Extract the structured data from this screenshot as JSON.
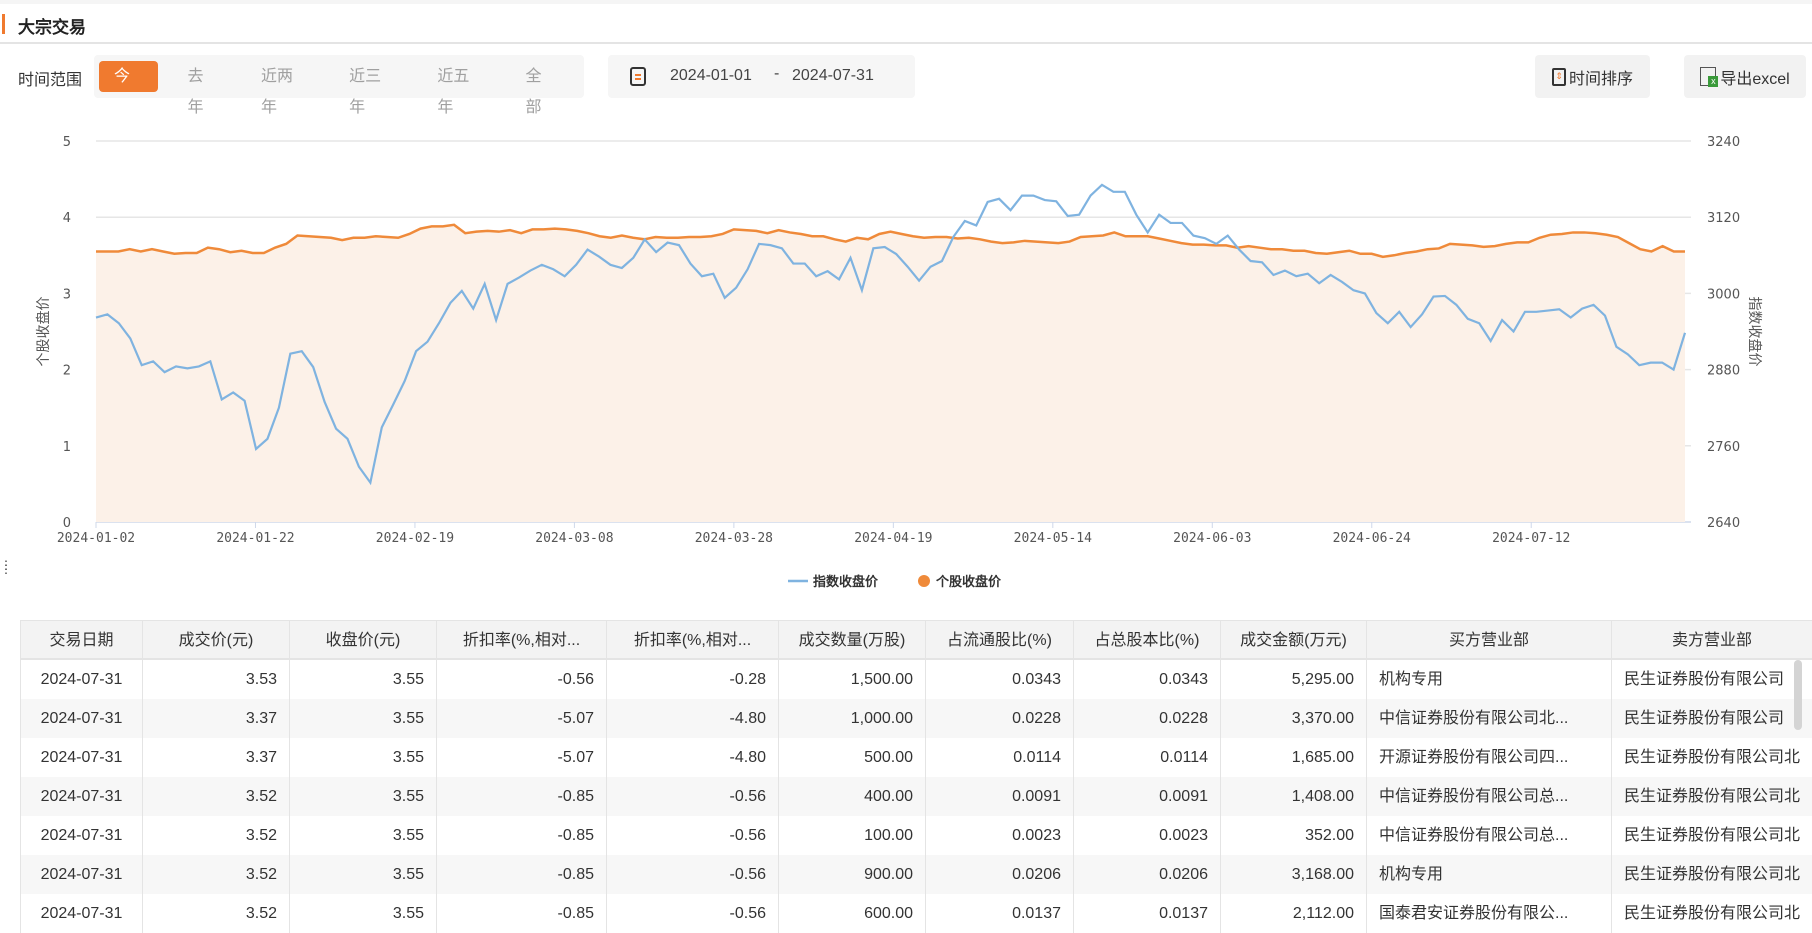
{
  "header": {
    "title": "大宗交易"
  },
  "filter": {
    "label": "时间范围",
    "ranges": [
      "今年",
      "去年",
      "近两年",
      "近三年",
      "近五年",
      "全部"
    ],
    "active": "今年"
  },
  "date_range": {
    "start": "2024-01-01",
    "sep": "-",
    "end": "2024-07-31"
  },
  "actions": {
    "sort_label": "时间排序",
    "export_label": "导出excel"
  },
  "colors": {
    "accent": "#f07a2f",
    "index_line": "#7fb3e0",
    "stock_line": "#ef8a3a",
    "area": "#fcf1e8"
  },
  "chart_data": {
    "type": "line",
    "left_ylabel": "个股收盘价",
    "right_ylabel": "指数收盘价",
    "left_ylim": [
      0,
      5
    ],
    "left_ticks": [
      "0",
      "1",
      "2",
      "3",
      "4",
      "5"
    ],
    "right_ylim": [
      2640,
      3240
    ],
    "right_ticks": [
      "2640",
      "2760",
      "2880",
      "3000",
      "3120",
      "3240"
    ],
    "x_intervals": 139.5,
    "x_ticks": [
      {
        "i": 0,
        "label": "2024-01-02"
      },
      {
        "i": 14,
        "label": "2024-01-22"
      },
      {
        "i": 28,
        "label": "2024-02-19"
      },
      {
        "i": 42,
        "label": "2024-03-08"
      },
      {
        "i": 56,
        "label": "2024-03-28"
      },
      {
        "i": 70,
        "label": "2024-04-19"
      },
      {
        "i": 84,
        "label": "2024-05-14"
      },
      {
        "i": 98,
        "label": "2024-06-03"
      },
      {
        "i": 112,
        "label": "2024-06-24"
      },
      {
        "i": 126,
        "label": "2024-07-12"
      }
    ],
    "legend": {
      "position": "bottom",
      "items": [
        "指数收盘价",
        "个股收盘价"
      ]
    },
    "series": [
      {
        "name": "指数收盘价",
        "axis": "right",
        "values": [
          2962,
          2967,
          2953,
          2929,
          2887,
          2893,
          2876,
          2885,
          2882,
          2885,
          2893,
          2833,
          2844,
          2831,
          2755,
          2771,
          2820,
          2905,
          2909,
          2884,
          2829,
          2787,
          2771,
          2727,
          2702,
          2789,
          2825,
          2862,
          2909,
          2924,
          2953,
          2985,
          3004,
          2976,
          3015,
          2958,
          3015,
          3025,
          3036,
          3045,
          3038,
          3027,
          3045,
          3069,
          3058,
          3045,
          3040,
          3056,
          3085,
          3065,
          3080,
          3076,
          3047,
          3027,
          3031,
          2993,
          3009,
          3038,
          3078,
          3076,
          3071,
          3047,
          3047,
          3027,
          3035,
          3022,
          3056,
          3005,
          3071,
          3073,
          3062,
          3042,
          3020,
          3042,
          3051,
          3089,
          3114,
          3107,
          3144,
          3149,
          3131,
          3154,
          3154,
          3147,
          3145,
          3122,
          3124,
          3154,
          3171,
          3160,
          3160,
          3124,
          3096,
          3124,
          3111,
          3111,
          3091,
          3087,
          3078,
          3091,
          3069,
          3051,
          3049,
          3029,
          3036,
          3027,
          3031,
          3016,
          3029,
          3018,
          3005,
          3000,
          2969,
          2953,
          2971,
          2947,
          2967,
          2995,
          2996,
          2982,
          2960,
          2953,
          2925,
          2958,
          2940,
          2971,
          2971,
          2973,
          2975,
          2962,
          2976,
          2982,
          2965,
          2916,
          2904,
          2887,
          2891,
          2891,
          2880,
          2938
        ]
      },
      {
        "name": "个股收盘价",
        "axis": "left",
        "values": [
          3.55,
          3.55,
          3.55,
          3.58,
          3.55,
          3.58,
          3.55,
          3.52,
          3.53,
          3.53,
          3.6,
          3.58,
          3.54,
          3.56,
          3.53,
          3.53,
          3.6,
          3.65,
          3.76,
          3.75,
          3.74,
          3.73,
          3.7,
          3.73,
          3.73,
          3.75,
          3.74,
          3.73,
          3.78,
          3.85,
          3.88,
          3.88,
          3.9,
          3.79,
          3.81,
          3.82,
          3.81,
          3.83,
          3.79,
          3.84,
          3.84,
          3.85,
          3.84,
          3.82,
          3.79,
          3.75,
          3.73,
          3.76,
          3.73,
          3.71,
          3.74,
          3.73,
          3.73,
          3.74,
          3.74,
          3.75,
          3.78,
          3.84,
          3.83,
          3.82,
          3.79,
          3.83,
          3.8,
          3.78,
          3.75,
          3.75,
          3.71,
          3.68,
          3.73,
          3.71,
          3.78,
          3.81,
          3.78,
          3.75,
          3.73,
          3.74,
          3.74,
          3.72,
          3.73,
          3.71,
          3.68,
          3.66,
          3.67,
          3.69,
          3.68,
          3.67,
          3.66,
          3.68,
          3.74,
          3.75,
          3.76,
          3.8,
          3.75,
          3.75,
          3.75,
          3.72,
          3.69,
          3.66,
          3.64,
          3.64,
          3.63,
          3.63,
          3.6,
          3.62,
          3.6,
          3.58,
          3.58,
          3.56,
          3.56,
          3.53,
          3.52,
          3.54,
          3.56,
          3.52,
          3.52,
          3.48,
          3.5,
          3.53,
          3.55,
          3.58,
          3.59,
          3.65,
          3.64,
          3.63,
          3.61,
          3.62,
          3.65,
          3.67,
          3.67,
          3.73,
          3.77,
          3.78,
          3.8,
          3.8,
          3.79,
          3.77,
          3.74,
          3.66,
          3.58,
          3.55,
          3.62,
          3.55,
          3.55
        ]
      }
    ]
  },
  "table": {
    "columns": [
      "交易日期",
      "成交价(元)",
      "收盘价(元)",
      "折扣率(%,相对...",
      "折扣率(%,相对...",
      "成交数量(万股)",
      "占流通股比(%)",
      "占总股本比(%)",
      "成交金额(万元)",
      "买方营业部",
      "卖方营业部"
    ],
    "rows": [
      [
        "2024-07-31",
        "3.53",
        "3.55",
        "-0.56",
        "-0.28",
        "1,500.00",
        "0.0343",
        "0.0343",
        "5,295.00",
        "机构专用",
        "民生证券股份有限公司"
      ],
      [
        "2024-07-31",
        "3.37",
        "3.55",
        "-5.07",
        "-4.80",
        "1,000.00",
        "0.0228",
        "0.0228",
        "3,370.00",
        "中信证券股份有限公司北...",
        "民生证券股份有限公司"
      ],
      [
        "2024-07-31",
        "3.37",
        "3.55",
        "-5.07",
        "-4.80",
        "500.00",
        "0.0114",
        "0.0114",
        "1,685.00",
        "开源证券股份有限公司四...",
        "民生证券股份有限公司北"
      ],
      [
        "2024-07-31",
        "3.52",
        "3.55",
        "-0.85",
        "-0.56",
        "400.00",
        "0.0091",
        "0.0091",
        "1,408.00",
        "中信证券股份有限公司总...",
        "民生证券股份有限公司北"
      ],
      [
        "2024-07-31",
        "3.52",
        "3.55",
        "-0.85",
        "-0.56",
        "100.00",
        "0.0023",
        "0.0023",
        "352.00",
        "中信证券股份有限公司总...",
        "民生证券股份有限公司北"
      ],
      [
        "2024-07-31",
        "3.52",
        "3.55",
        "-0.85",
        "-0.56",
        "900.00",
        "0.0206",
        "0.0206",
        "3,168.00",
        "机构专用",
        "民生证券股份有限公司北"
      ],
      [
        "2024-07-31",
        "3.52",
        "3.55",
        "-0.85",
        "-0.56",
        "600.00",
        "0.0137",
        "0.0137",
        "2,112.00",
        "国泰君安证券股份有限公...",
        "民生证券股份有限公司北"
      ]
    ]
  }
}
